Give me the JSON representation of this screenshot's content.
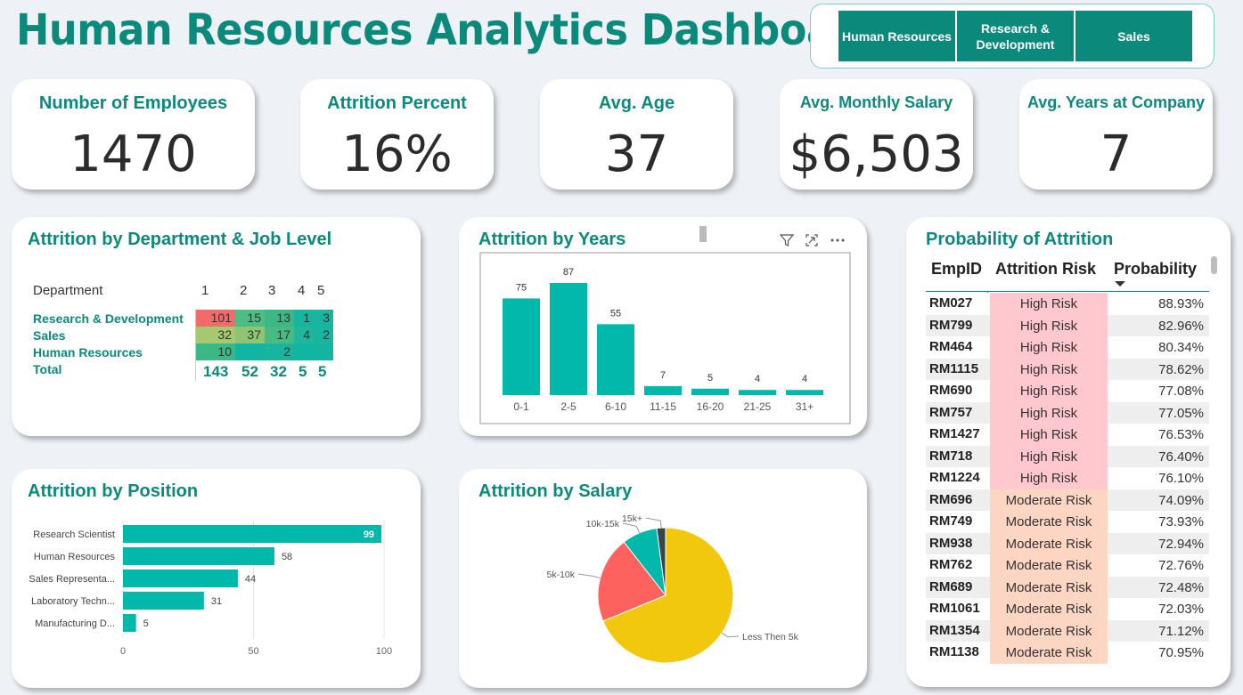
{
  "header": {
    "title": "Human Resources Analytics Dashboard"
  },
  "slicer": {
    "buttons": [
      "Human Resources",
      "Research & Development",
      "Sales"
    ],
    "color": "#0b8a7b"
  },
  "kpis": [
    {
      "label": "Number of Employees",
      "value": "1470"
    },
    {
      "label": "Attrition Percent",
      "value": "16%"
    },
    {
      "label": "Avg. Age",
      "value": "37"
    },
    {
      "label": "Avg. Monthly Salary",
      "value": "$6,503"
    },
    {
      "label": "Avg. Years at Company",
      "value": "7"
    }
  ],
  "dept_matrix": {
    "title": "Attrition by Department & Job Level",
    "row_header": "Department",
    "columns": [
      "1",
      "2",
      "3",
      "4",
      "5"
    ],
    "rows": [
      {
        "label": "Research & Development",
        "values": [
          "101",
          "15",
          "13",
          "1",
          "3"
        ]
      },
      {
        "label": "Sales",
        "values": [
          "32",
          "37",
          "17",
          "4",
          "2"
        ]
      },
      {
        "label": "Human Resources",
        "values": [
          "10",
          "",
          "2",
          "",
          ""
        ]
      }
    ],
    "total_label": "Total",
    "totals": [
      "143",
      "52",
      "32",
      "5",
      "5"
    ]
  },
  "years_chart": {
    "title": "Attrition by Years",
    "chart_data": {
      "type": "bar",
      "categories": [
        "0-1",
        "2-5",
        "6-10",
        "11-15",
        "16-20",
        "21-25",
        "31+"
      ],
      "values": [
        75,
        87,
        55,
        7,
        5,
        4,
        4
      ],
      "color": "#01b8aa"
    }
  },
  "attrition_table": {
    "title": "Probability of Attrition",
    "columns": [
      "EmpID",
      "Attrition Risk",
      "Probability"
    ],
    "rows": [
      {
        "id": "RM027",
        "risk": "High Risk",
        "prob": "88.93%"
      },
      {
        "id": "RM799",
        "risk": "High Risk",
        "prob": "82.96%"
      },
      {
        "id": "RM464",
        "risk": "High Risk",
        "prob": "80.34%"
      },
      {
        "id": "RM1115",
        "risk": "High Risk",
        "prob": "78.62%"
      },
      {
        "id": "RM690",
        "risk": "High Risk",
        "prob": "77.08%"
      },
      {
        "id": "RM757",
        "risk": "High Risk",
        "prob": "77.05%"
      },
      {
        "id": "RM1427",
        "risk": "High Risk",
        "prob": "76.53%"
      },
      {
        "id": "RM718",
        "risk": "High Risk",
        "prob": "76.40%"
      },
      {
        "id": "RM1224",
        "risk": "High Risk",
        "prob": "76.10%"
      },
      {
        "id": "RM696",
        "risk": "Moderate Risk",
        "prob": "74.09%"
      },
      {
        "id": "RM749",
        "risk": "Moderate Risk",
        "prob": "73.93%"
      },
      {
        "id": "RM938",
        "risk": "Moderate Risk",
        "prob": "72.94%"
      },
      {
        "id": "RM762",
        "risk": "Moderate Risk",
        "prob": "72.76%"
      },
      {
        "id": "RM689",
        "risk": "Moderate Risk",
        "prob": "72.48%"
      },
      {
        "id": "RM1061",
        "risk": "Moderate Risk",
        "prob": "72.03%"
      },
      {
        "id": "RM1354",
        "risk": "Moderate Risk",
        "prob": "71.12%"
      },
      {
        "id": "RM1138",
        "risk": "Moderate Risk",
        "prob": "70.95%"
      }
    ],
    "high_risk_color": "#ffc7ce",
    "moderate_risk_color": "#fcd5c3"
  },
  "position_chart": {
    "title": "Attrition by Position",
    "chart_data": {
      "type": "bar",
      "orientation": "horizontal",
      "categories": [
        "Research Scientist",
        "Human Resources",
        "Sales Representa...",
        "Laboratory Techn...",
        "Manufacturing D..."
      ],
      "values": [
        99,
        58,
        44,
        31,
        5
      ],
      "xticks": [
        "0",
        "50",
        "100"
      ],
      "xlim": [
        0,
        100
      ],
      "color": "#01b8aa"
    }
  },
  "salary_chart": {
    "title": "Attrition by Salary",
    "chart_data": {
      "type": "pie",
      "labels": [
        "Less Then 5k",
        "5k-10k",
        "10k-15k",
        "15k+"
      ],
      "values": [
        163,
        49,
        20,
        5
      ],
      "colors": [
        "#f2c80f",
        "#fd625e",
        "#01b8aa",
        "#374649"
      ]
    }
  }
}
